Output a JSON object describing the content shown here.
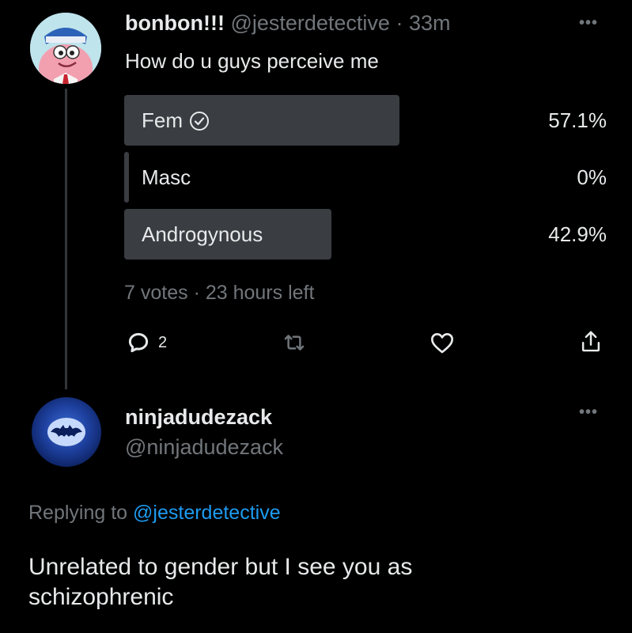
{
  "tweet": {
    "display_name": "bonbon!!!",
    "handle": "@jesterdetective",
    "separator": "·",
    "time": "33m",
    "text": "How do u guys perceive me",
    "avatar_icon": "cartoon-avatar-icon",
    "more_icon": "more-options-icon"
  },
  "poll": {
    "options": [
      {
        "label": "Fem",
        "percent": "57.1%",
        "fraction": 0.571,
        "selected": true
      },
      {
        "label": "Masc",
        "percent": "0%",
        "fraction": 0.0,
        "selected": false
      },
      {
        "label": "Androgynous",
        "percent": "42.9%",
        "fraction": 0.429,
        "selected": false
      }
    ],
    "votes": "7 votes",
    "separator": "·",
    "time_left": "23 hours left"
  },
  "actions": {
    "reply_count": "2",
    "retweet_count": "",
    "like_count": ""
  },
  "reply": {
    "display_name": "ninjadudezack",
    "handle": "@ninjadudezack",
    "replying_prefix": "Replying to",
    "replying_to": "@jesterdetective",
    "text": "Unrelated to gender but I see you as schizophrenic"
  },
  "colors": {
    "background": "#000000",
    "text": "#e7e9ea",
    "muted": "#71767b",
    "poll_bar": "#3a3d41",
    "link": "#1d9bf0"
  }
}
